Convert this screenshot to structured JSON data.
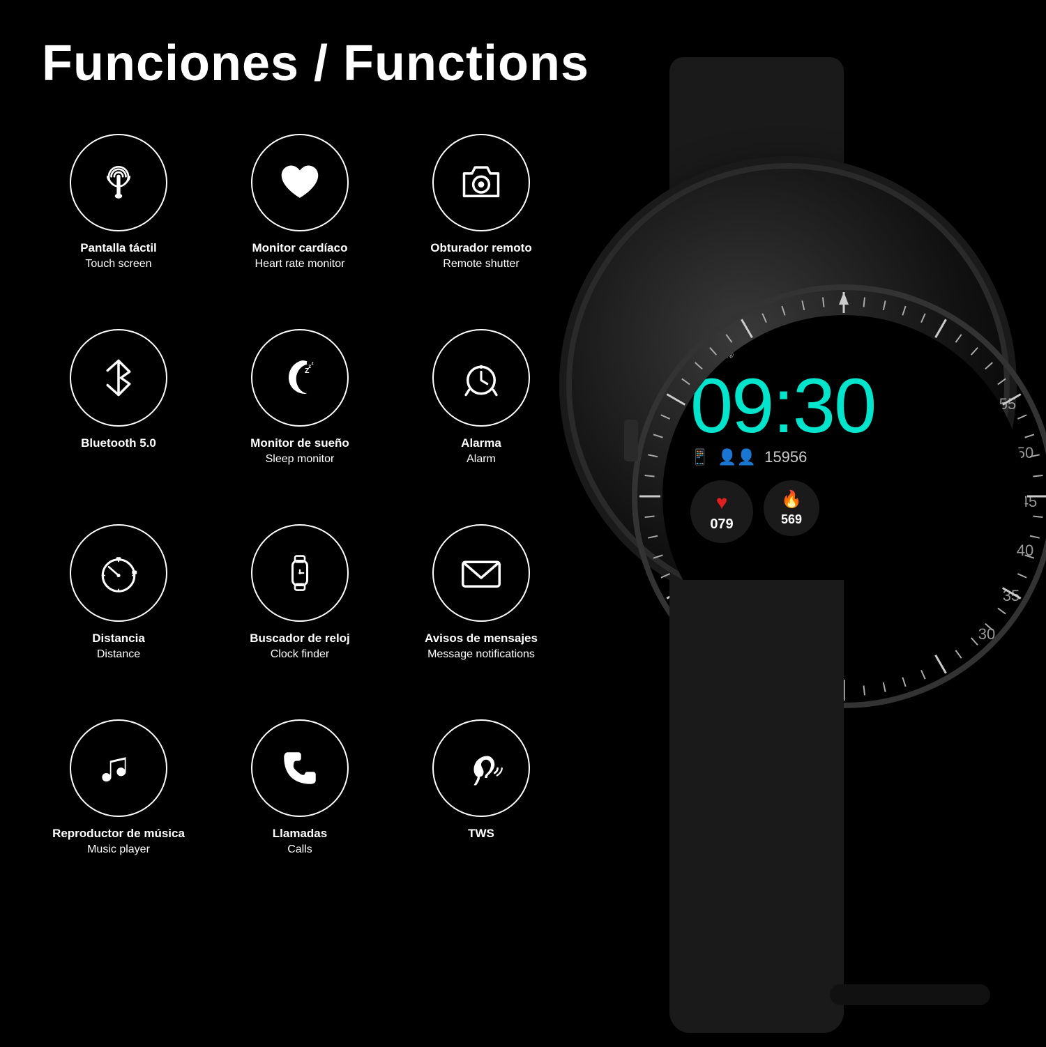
{
  "page": {
    "title": "Funciones / Functions",
    "background": "#000000"
  },
  "features": [
    {
      "id": "touch-screen",
      "icon": "touch",
      "label_es": "Pantalla táctil",
      "label_en": "Touch screen"
    },
    {
      "id": "heart-rate",
      "icon": "heart",
      "label_es": "Monitor cardíaco",
      "label_en": "Heart rate monitor"
    },
    {
      "id": "remote-shutter",
      "icon": "camera",
      "label_es": "Obturador remoto",
      "label_en": "Remote shutter"
    },
    {
      "id": "bluetooth",
      "icon": "bluetooth",
      "label_es": "Bluetooth 5.0",
      "label_en": ""
    },
    {
      "id": "sleep-monitor",
      "icon": "sleep",
      "label_es": "Monitor de sueño",
      "label_en": "Sleep monitor"
    },
    {
      "id": "alarm",
      "icon": "alarm",
      "label_es": "Alarma",
      "label_en": "Alarm"
    },
    {
      "id": "distance",
      "icon": "distance",
      "label_es": "Distancia",
      "label_en": "Distance"
    },
    {
      "id": "clock-finder",
      "icon": "watch",
      "label_es": "Buscador de reloj",
      "label_en": "Clock finder"
    },
    {
      "id": "notifications",
      "icon": "envelope",
      "label_es": "Avisos de mensajes",
      "label_en": "Message notifications"
    },
    {
      "id": "music",
      "icon": "music",
      "label_es": "Reproductor de música",
      "label_en": "Music player"
    },
    {
      "id": "calls",
      "icon": "phone",
      "label_es": "Llamadas",
      "label_en": "Calls"
    },
    {
      "id": "tws",
      "icon": "ear",
      "label_es": "TWS",
      "label_en": ""
    }
  ],
  "watch": {
    "date": "10/2",
    "time": "09:30",
    "steps": "15956",
    "heart_rate": "079",
    "calories": "569"
  }
}
